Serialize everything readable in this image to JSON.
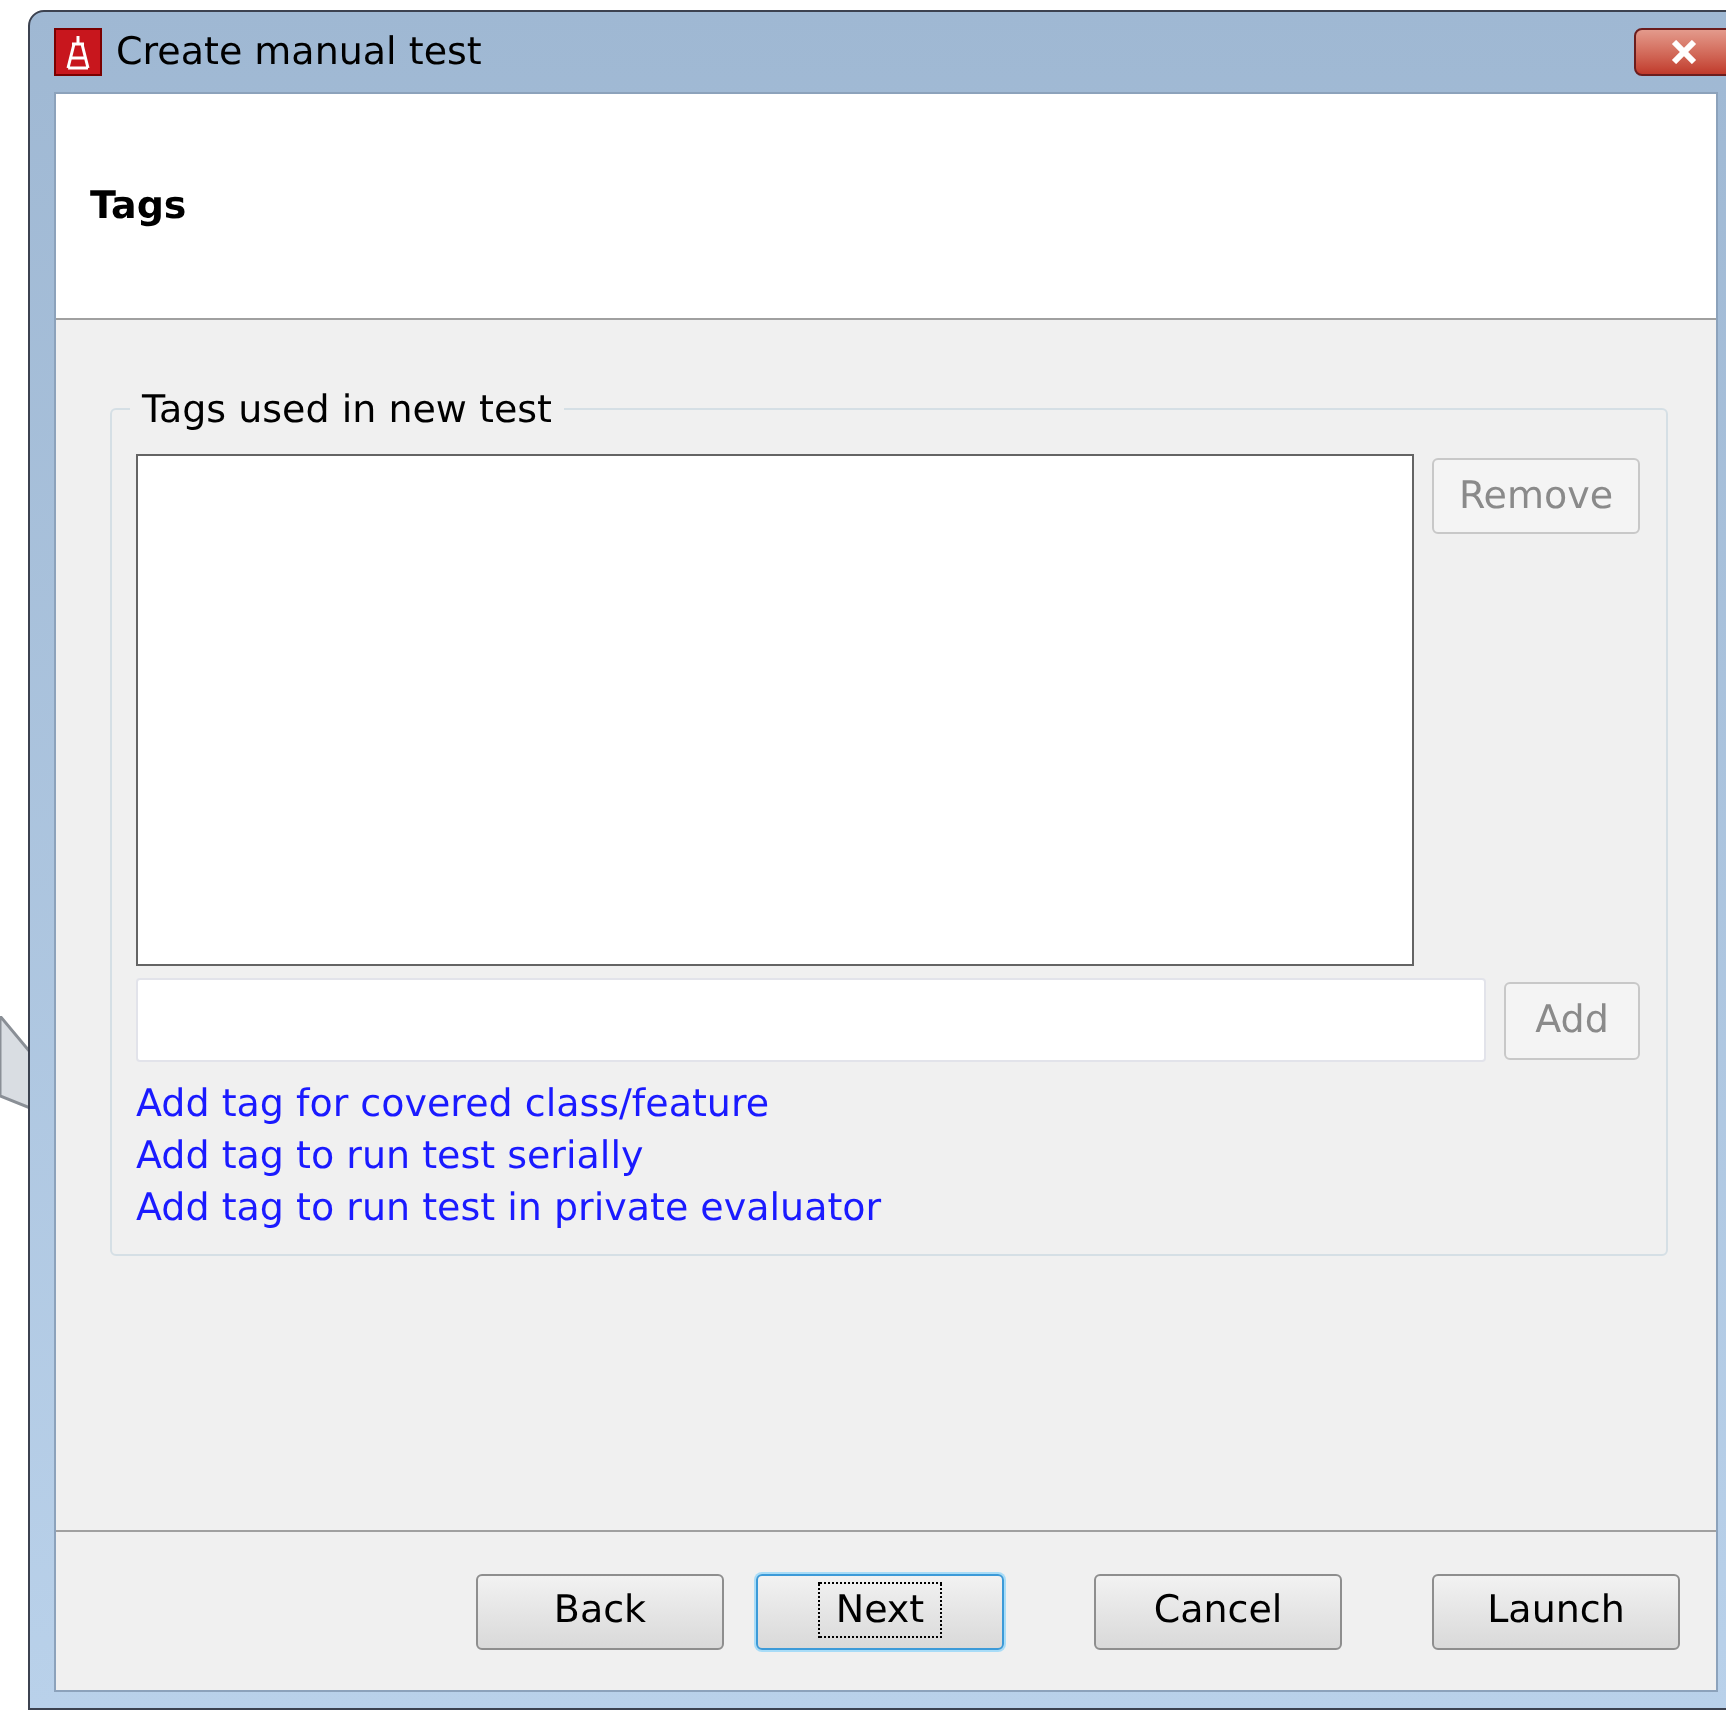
{
  "window": {
    "title": "Create manual test"
  },
  "header": {
    "title": "Tags"
  },
  "tags_group": {
    "title": "Tags used in new test",
    "remove_button": {
      "label": "Remove",
      "disabled": true
    },
    "add_button": {
      "label": "Add",
      "disabled": true
    },
    "links": [
      "Add tag for covered class/feature",
      "Add tag to run test serially",
      "Add tag to run test in private evaluator"
    ]
  },
  "buttons": [
    {
      "label": "Back",
      "focused": false
    },
    {
      "label": "Next",
      "focused": true
    },
    {
      "label": "Cancel",
      "focused": false
    },
    {
      "label": "Launch",
      "focused": false
    }
  ]
}
